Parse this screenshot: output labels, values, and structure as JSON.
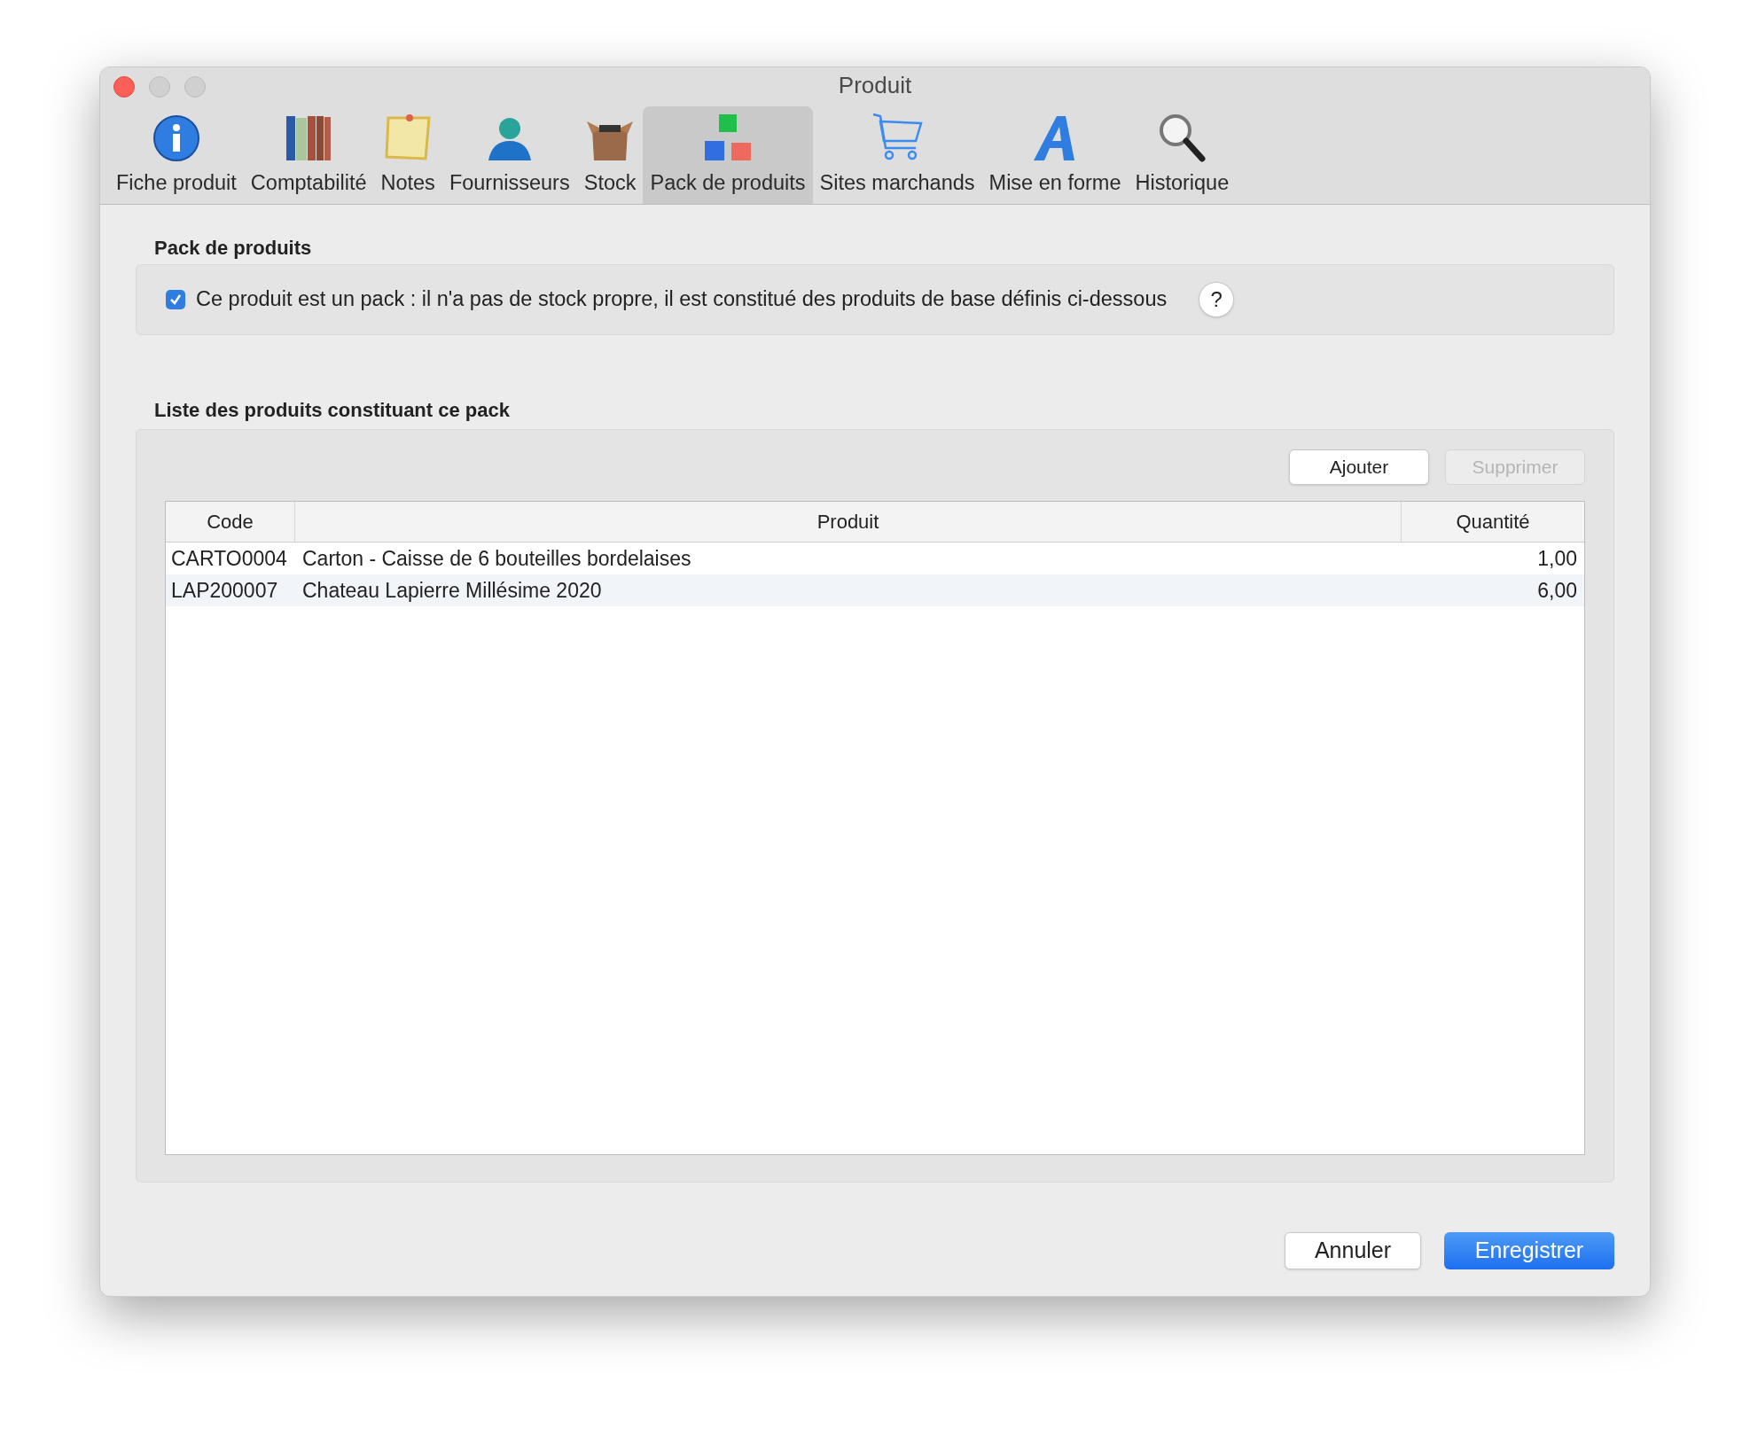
{
  "window": {
    "title": "Produit"
  },
  "toolbar": {
    "items": [
      {
        "label": "Fiche produit",
        "selected": false
      },
      {
        "label": "Comptabilité",
        "selected": false
      },
      {
        "label": "Notes",
        "selected": false
      },
      {
        "label": "Fournisseurs",
        "selected": false
      },
      {
        "label": "Stock",
        "selected": false
      },
      {
        "label": "Pack de produits",
        "selected": true
      },
      {
        "label": "Sites marchands",
        "selected": false
      },
      {
        "label": "Mise en forme",
        "selected": false
      },
      {
        "label": "Historique",
        "selected": false
      }
    ]
  },
  "pack_section": {
    "title": "Pack de produits",
    "checkbox": {
      "label": "Ce produit est un pack : il n'a pas de stock propre, il est constitué des produits de base définis ci-dessous",
      "checked": true
    },
    "help": "?"
  },
  "list_section": {
    "title": "Liste des produits constituant ce pack",
    "buttons": [
      {
        "label": "Ajouter",
        "disabled": false
      },
      {
        "label": "Supprimer",
        "disabled": true
      }
    ],
    "table": {
      "columns": [
        "Code",
        "Produit",
        "Quantité"
      ],
      "rows": [
        [
          "CARTO0004",
          "Carton - Caisse de 6 bouteilles bordelaises",
          "1,00"
        ],
        [
          "LAP200007",
          "Chateau Lapierre Millésime 2020",
          "6,00"
        ]
      ]
    }
  },
  "footer": {
    "buttons": [
      {
        "label": "Annuler",
        "kind": "default"
      },
      {
        "label": "Enregistrer",
        "kind": "primary"
      }
    ]
  }
}
